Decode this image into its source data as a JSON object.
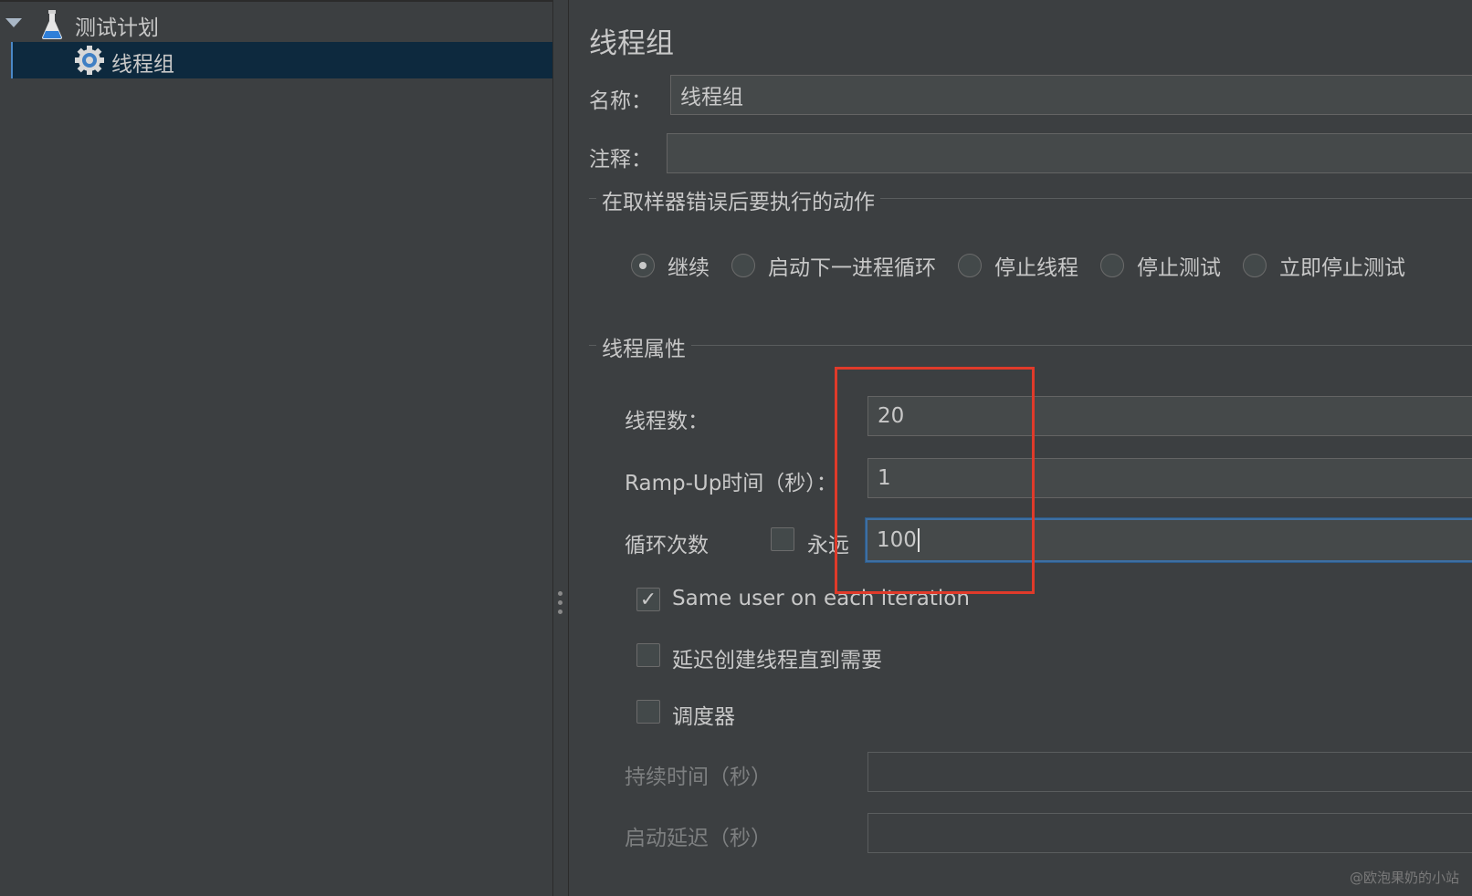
{
  "tree": {
    "root_label": "测试计划",
    "child_label": "线程组"
  },
  "panel": {
    "title": "线程组",
    "name_label": "名称：",
    "name_value": "线程组",
    "comment_label": "注释：",
    "comment_value": ""
  },
  "sampler_error": {
    "group_title": "在取样器错误后要执行的动作",
    "options": [
      {
        "label": "继续",
        "selected": true
      },
      {
        "label": "启动下一进程循环",
        "selected": false
      },
      {
        "label": "停止线程",
        "selected": false
      },
      {
        "label": "停止测试",
        "selected": false
      },
      {
        "label": "立即停止测试",
        "selected": false
      }
    ]
  },
  "thread_props": {
    "group_title": "线程属性",
    "thread_count_label": "线程数：",
    "thread_count_value": "20",
    "rampup_label": "Ramp-Up时间（秒）：",
    "rampup_value": "1",
    "loop_label": "循环次数",
    "forever_label": "永远",
    "forever_checked": false,
    "loop_value": "100",
    "same_user_label": "Same user on each iteration",
    "same_user_checked": true,
    "delay_create_label": "延迟创建线程直到需要",
    "delay_create_checked": false,
    "scheduler_label": "调度器",
    "scheduler_checked": false,
    "duration_label": "持续时间（秒）",
    "duration_value": "",
    "startup_delay_label": "启动延迟（秒）",
    "startup_delay_value": ""
  },
  "watermark": "@欧泡果奶的小站",
  "colors": {
    "background": "#3c3f41",
    "selection": "#0d293e",
    "highlight": "#e03a2a",
    "focus": "#3d6fa3"
  }
}
